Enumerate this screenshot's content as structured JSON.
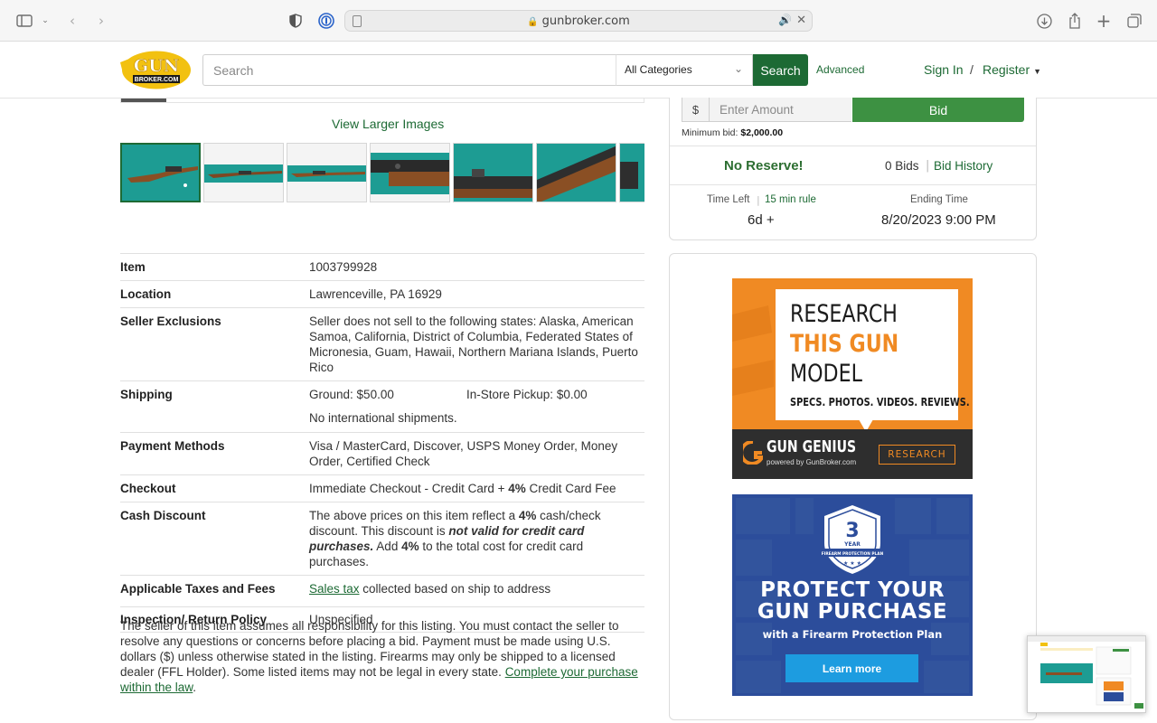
{
  "browser": {
    "url": "gunbroker.com"
  },
  "header": {
    "logo_text_top": "GUN",
    "logo_text_bottom": "BROKER.COM",
    "search_placeholder": "Search",
    "category_selected": "All Categories",
    "search_button": "Search",
    "advanced_link": "Advanced",
    "sign_in": "Sign In",
    "separator": "/",
    "register": "Register"
  },
  "gallery": {
    "view_larger": "View Larger Images",
    "thumb_count": 7
  },
  "details": {
    "item_label": "Item",
    "item_value": "1003799928",
    "location_label": "Location",
    "location_value": "Lawrenceville, PA 16929",
    "exclusions_label": "Seller Exclusions",
    "exclusions_value": "Seller does not sell to the following states: Alaska, American Samoa, California, District of Columbia, Federated States of Micronesia, Guam, Hawaii, Northern Mariana Islands, Puerto Rico",
    "shipping_label": "Shipping",
    "shipping_ground_label": "Ground:",
    "shipping_ground_value": "$50.00",
    "shipping_pickup_label": "In-Store Pickup:",
    "shipping_pickup_value": "$0.00",
    "shipping_note": "No international shipments.",
    "payment_label": "Payment Methods",
    "payment_value": "Visa / MasterCard, Discover, USPS Money Order, Money Order, Certified Check",
    "checkout_label": "Checkout",
    "checkout_pre": "Immediate Checkout - Credit Card + ",
    "checkout_pct": "4%",
    "checkout_post": " Credit Card Fee",
    "cash_label": "Cash Discount",
    "cash_1": "The above prices on this item reflect a ",
    "cash_pct1": "4%",
    "cash_2": " cash/check discount. This discount is ",
    "cash_em": "not valid for credit card purchases.",
    "cash_3": " Add ",
    "cash_pct2": "4%",
    "cash_4": " to the total cost for credit card purchases.",
    "taxes_label": "Applicable Taxes and Fees",
    "taxes_link": "Sales tax",
    "taxes_rest": " collected based on ship to address",
    "inspection_label": "Inspection/ Return Policy",
    "inspection_value": "Unspecified"
  },
  "legal": {
    "text": "The seller of this item assumes all responsibility for this listing. You must contact the seller to resolve any questions or concerns before placing a bid. Payment must be made using U.S. dollars ($) unless otherwise stated in the listing. Firearms may only be shipped to a licensed dealer (FFL Holder). Some listed items may not be legal in every state. ",
    "link": "Complete your purchase within the law",
    "end": "."
  },
  "bid": {
    "currency": "$",
    "amount_placeholder": "Enter Amount",
    "bid_button": "Bid",
    "min_bid_label": "Minimum bid:",
    "min_bid_value": "$2,000.00",
    "no_reserve": "No Reserve!",
    "bids_count": "0 Bids",
    "bid_history": "Bid History",
    "time_left_label": "Time Left",
    "rule_link": "15 min rule",
    "time_left_value": "6d +",
    "ending_label": "Ending Time",
    "ending_value": "8/20/2023 9:00 PM"
  },
  "ads": {
    "ad1_line1": "RESEARCH",
    "ad1_line2": "THIS GUN",
    "ad1_line3": "MODEL",
    "ad1_sub": "SPECS. PHOTOS. VIDEOS. REVIEWS.",
    "ad1_brand": "GUN GENIUS",
    "ad1_brand_sub": "powered by GunBroker.com",
    "ad1_button": "RESEARCH",
    "ad2_badge_num": "3",
    "ad2_badge_year": "YEAR",
    "ad2_badge_text": "FIREARM PROTECTION PLAN",
    "ad2_line1": "PROTECT YOUR",
    "ad2_line2": "GUN PURCHASE",
    "ad2_line3": "with a Firearm Protection Plan",
    "ad2_button": "Learn more"
  },
  "colors": {
    "brand_green": "#1d6a34",
    "bid_green": "#3d9142",
    "ad_orange": "#f08a23",
    "ad_blue": "#2c4d9b"
  }
}
